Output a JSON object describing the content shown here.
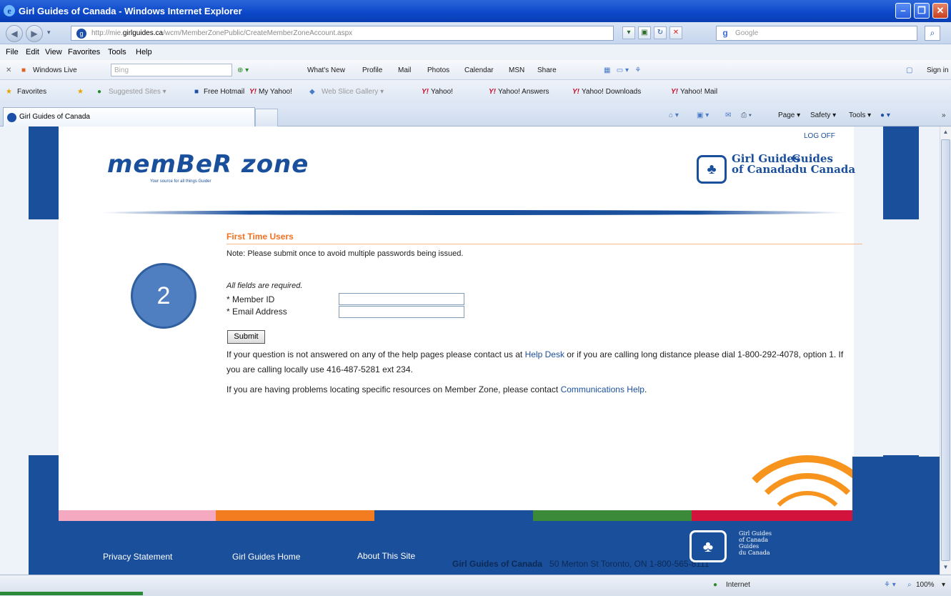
{
  "window": {
    "title": "Girl Guides of Canada - Windows Internet Explorer"
  },
  "address": {
    "url_prefix": "http://mie.",
    "url_domain": "girlguides.ca",
    "url_path": "/wcm/MemberZonePublic/CreateMemberZoneAccount.aspx",
    "search_placeholder": "Google"
  },
  "menu": [
    "File",
    "Edit",
    "View",
    "Favorites",
    "Tools",
    "Help"
  ],
  "live_bar": {
    "brand": "Windows Live",
    "search_placeholder": "Bing",
    "items": [
      "What's New",
      "Profile",
      "Mail",
      "Photos",
      "Calendar",
      "MSN",
      "Share"
    ],
    "sign_in": "Sign in"
  },
  "favorites_bar": {
    "favorites": "Favorites",
    "items": [
      "Suggested Sites ▾",
      "Free Hotmail",
      "My Yahoo!",
      "Web Slice Gallery ▾",
      "Yahoo!",
      "Yahoo! Answers",
      "Yahoo! Downloads",
      "Yahoo! Mail"
    ]
  },
  "tab": {
    "label": "Girl Guides of Canada",
    "tools": [
      "Page ▾",
      "Safety ▾",
      "Tools ▾"
    ]
  },
  "page": {
    "log_off": "LOG OFF",
    "logo_text": "memBeR zone",
    "logo_tagline": "Your source for all things Guider",
    "org_en": [
      "Girl Guides",
      "of Canada"
    ],
    "org_fr": [
      "Guides",
      "du Canada"
    ],
    "section_title": "First Time Users",
    "note": "Note: Please submit once to avoid multiple passwords being issued.",
    "badge": "2",
    "required": "All fields are required.",
    "member_id_label": "* Member ID",
    "email_label": "* Email Address",
    "member_id_value": "",
    "email_value": "",
    "submit": "Submit",
    "help_text_1": "If your question is not answered on any of the help pages please contact us at ",
    "help_link_1": "Help Desk",
    "help_text_2": " or if you are calling long distance please dial 1-800-292-4078, option 1. If you are calling locally use 416-487-5281 ext 234.",
    "help_text_3": "If you are having problems locating specific resources on Member Zone, please contact ",
    "help_link_2": "Communications Help",
    "help_text_4": "."
  },
  "footer": {
    "links": [
      "Privacy Statement",
      "Girl Guides Home",
      "About This Site"
    ],
    "address_org": "Girl Guides of Canada",
    "address_rest": "50 Merton St   Toronto, ON   1-800-565-8111",
    "logo_lines": [
      "Girl Guides",
      "of Canada",
      "Guides",
      "du Canada"
    ]
  },
  "colors": {
    "stripe": [
      "#f4a9c0",
      "#f47c20",
      "#1a4f9c",
      "#3a8a3a",
      "#d2143c"
    ],
    "brand_blue": "#1a4f9c",
    "accent_orange": "#f37021"
  },
  "status": {
    "zone": "Internet",
    "zoom": "100%"
  }
}
